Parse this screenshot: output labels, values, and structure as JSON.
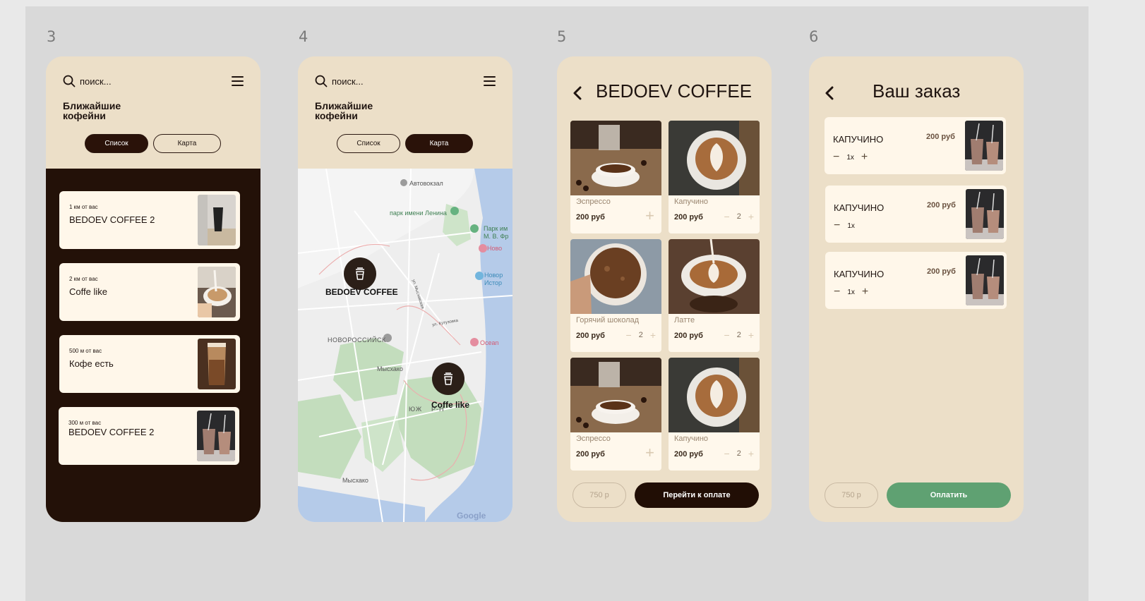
{
  "frames": {
    "f3": {
      "number": "3"
    },
    "f4": {
      "number": "4"
    },
    "f5": {
      "number": "5"
    },
    "f6": {
      "number": "6"
    }
  },
  "header": {
    "search_placeholder": "поиск...",
    "nearby_title": "Ближайшие кофейни",
    "tab_list": "Список",
    "tab_map": "Карта"
  },
  "shops": [
    {
      "distance": "1 км от вас",
      "name": "BEDOEV COFFEE 2"
    },
    {
      "distance": "2 км от вас",
      "name": "Coffe like"
    },
    {
      "distance": "500 м от вас",
      "name": "Кофе есть"
    },
    {
      "distance": "300 м от вас",
      "name": "BEDOEV COFFEE 2"
    }
  ],
  "map": {
    "pin1_label": "BEDOEV COFFEE",
    "pin2_label": "Coffe like",
    "places": [
      "Автовокзал",
      "парк имени Ленина",
      "Парк им",
      "М. В. Фр",
      "Ново",
      "Новор",
      "Истор",
      "НОВОРОССИЙСК",
      "Ocean",
      "Мысхако",
      "ЮЖ",
      "Р-Н",
      "Мысхако",
      "ул. Кутузовка",
      "ул. Мысхакская"
    ],
    "provider": "Google"
  },
  "menu": {
    "shop_title": "BEDOEV COFFEE",
    "products": [
      {
        "name": "Эспрессо",
        "price": "200 руб",
        "qty": ""
      },
      {
        "name": "Капучино",
        "price": "200 руб",
        "qty": "2"
      },
      {
        "name": "Горячий шоколад",
        "price": "200 руб",
        "qty": "2"
      },
      {
        "name": "Латте",
        "price": "200 руб",
        "qty": "2"
      },
      {
        "name": "Эспрессо",
        "price": "200 руб",
        "qty": ""
      },
      {
        "name": "Капучино",
        "price": "200 руб",
        "qty": "2"
      }
    ],
    "total": "750 р",
    "checkout_label": "Перейти к оплате"
  },
  "order": {
    "title": "Ваш заказ",
    "items": [
      {
        "name": "КАПУЧИНО",
        "price": "200 руб",
        "qty": "1х"
      },
      {
        "name": "КАПУЧИНО",
        "price": "200 руб",
        "qty": "1х"
      },
      {
        "name": "КАПУЧИНО",
        "price": "200 руб",
        "qty": "1х"
      }
    ],
    "total": "750 р",
    "pay_label": "Оплатить"
  },
  "colors": {
    "dark_brown": "#231108",
    "cream": "#ecdfc8",
    "card": "#fff7ea",
    "green": "#5fa172"
  }
}
